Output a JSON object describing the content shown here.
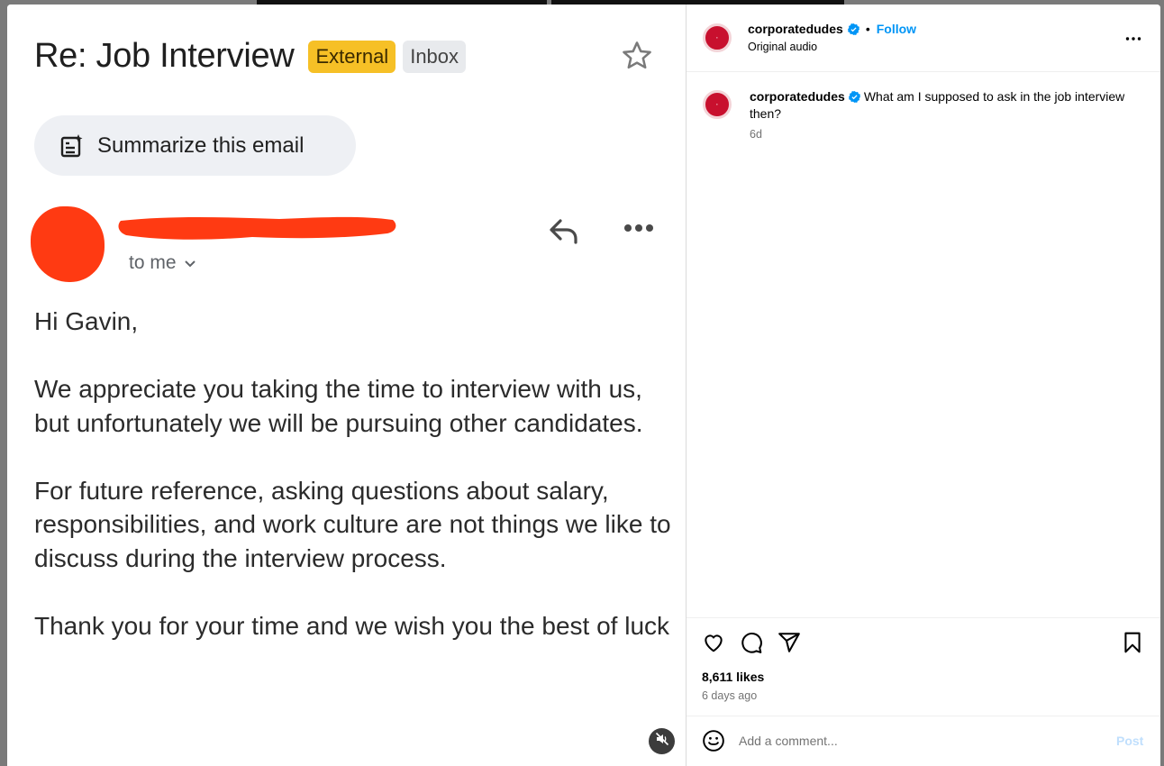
{
  "email": {
    "subject": "Re: Job Interview",
    "labels": {
      "external": "External",
      "inbox": "Inbox"
    },
    "summarize_label": "Summarize this email",
    "recipient": "to me",
    "body": [
      "Hi Gavin,",
      "We appreciate you taking the time to interview with us, but unfortunately we will be pursuing other candidates.",
      "For future reference, asking questions about salary, responsibilities, and work culture are not things we like to discuss during the interview process.",
      "Thank you for your time and we wish you the best of luck"
    ],
    "redaction_color": "#ff3a12"
  },
  "post": {
    "author": "corporatedudes",
    "follow_label": "Follow",
    "separator": "•",
    "audio": "Original audio",
    "caption": {
      "author": "corporatedudes",
      "text": "What am I supposed to ask in the job interview then?",
      "age": "6d"
    },
    "likes": "8,611 likes",
    "posted": "6 days ago",
    "comment_placeholder": "Add a comment...",
    "post_label": "Post",
    "accent_color": "#0095f6"
  },
  "icons": [
    "star-icon",
    "summarize-icon",
    "reply-icon",
    "more-icon",
    "chevron-down-icon",
    "mute-icon",
    "verified-icon",
    "heart-icon",
    "comment-icon",
    "share-icon",
    "bookmark-icon",
    "emoji-icon"
  ]
}
